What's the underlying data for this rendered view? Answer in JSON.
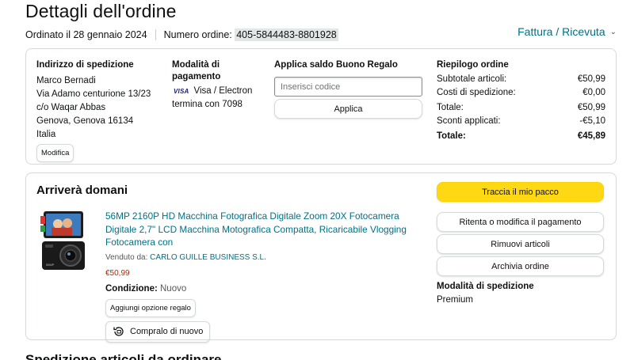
{
  "header": {
    "title": "Dettagli dell'ordine",
    "ordered_on": "Ordinato il 28 gennaio 2024",
    "order_number_label": "Numero ordine:",
    "order_number": "405-5844483-8801928",
    "invoice_link": "Fattura / Ricevuta"
  },
  "shipping": {
    "heading": "Indirizzo di spedizione",
    "lines": [
      "Marco Bernadi",
      "Via Adamo centurione 13/23",
      "c/o Waqar Abbas",
      "Genova, Genova 16134",
      "Italia"
    ],
    "edit_label": "Modifica"
  },
  "payment": {
    "heading": "Modalità di pagamento",
    "card_logo": "VISA",
    "card_text": "Visa / Electron",
    "card_end": "termina con 7098"
  },
  "gift": {
    "heading": "Applica saldo Buono Regalo",
    "placeholder": "Inserisci codice",
    "apply_label": "Applica"
  },
  "summary": {
    "heading": "Riepilogo ordine",
    "rows": [
      {
        "label": "Subtotale articoli:",
        "value": "€50,99"
      },
      {
        "label": "Costi di spedizione:",
        "value": "€0,00"
      },
      {
        "label": "Totale:",
        "value": "€50,99"
      },
      {
        "label": "Sconti applicati:",
        "value": "-€5,10"
      },
      {
        "label": "Totale:",
        "value": "€45,89"
      }
    ]
  },
  "shipment": {
    "heading": "Arriverà domani",
    "product": {
      "title": "56MP 2160P HD Macchina Fotografica Digitale Zoom 20X Fotocamera Digitale 2,7\" LCD Macchina Motografica Compatta, Ricaricabile Vlogging Fotocamera con",
      "sold_by_label": "Venduto da:",
      "seller": "CARLO GUILLE BUSINESS S.L.",
      "price": "€50,99",
      "condition_label": "Condizione:",
      "condition_value": "Nuovo",
      "gift_option_label": "Aggiungi opzione regalo",
      "buy_again_label": "Compralo di nuovo"
    },
    "actions": {
      "track": "Traccia il mio pacco",
      "retry_payment": "Ritenta o modifica il pagamento",
      "remove_items": "Rimuovi articoli",
      "archive": "Archivia ordine"
    },
    "shipping_method_label": "Modalità di spedizione",
    "shipping_method_value": "Premium"
  },
  "next_section_heading": "Spedizione articoli da ordinare",
  "colors": {
    "link": "#007185",
    "primary_button": "#ffd814",
    "price": "#b12704",
    "border": "#d5d9d9"
  }
}
